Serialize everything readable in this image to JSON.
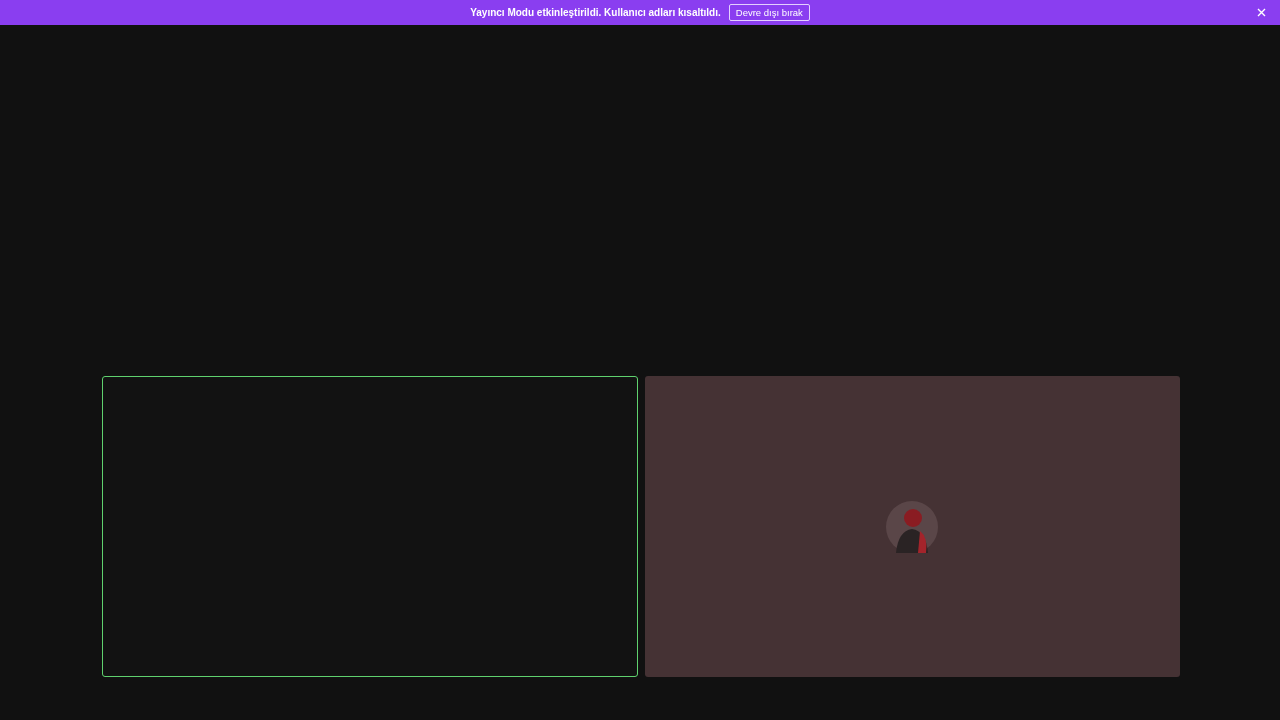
{
  "banner": {
    "message": "Yayıncı Modu etkinleştirildi. Kullanıcı adları kısaltıldı.",
    "action": "Devre dışı bırak"
  },
  "tiles": [
    {
      "kind": "empty",
      "speaking": true
    },
    {
      "kind": "avatar",
      "speaking": false
    }
  ]
}
